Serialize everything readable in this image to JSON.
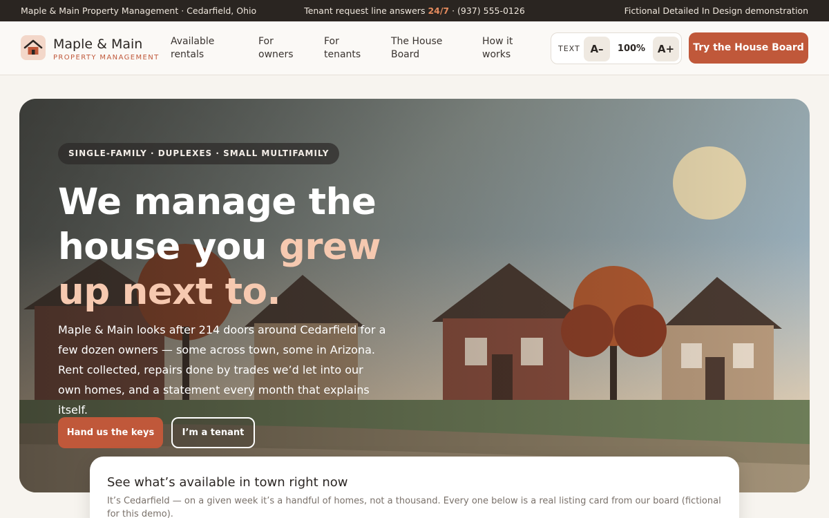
{
  "topbar": {
    "left": "Maple & Main Property Management · Cedarfield, Ohio",
    "center_prefix": "Tenant request line answers ",
    "center_accent": "24/7",
    "center_suffix": " · (937) 555-0126",
    "right": "Fictional Detailed In Design demonstration"
  },
  "brand": {
    "name": "Maple & Main",
    "tagline": "PROPERTY MANAGEMENT",
    "logo_icon": "house-icon"
  },
  "nav": {
    "items": [
      {
        "line1": "Available",
        "line2": "rentals"
      },
      {
        "line1": "For",
        "line2": "owners"
      },
      {
        "line1": "For",
        "line2": "tenants"
      },
      {
        "line1": "The House",
        "line2": "Board"
      },
      {
        "line1": "How it",
        "line2": "works"
      }
    ]
  },
  "text_control": {
    "label": "TEXT",
    "decrease": "A–",
    "value": "100%",
    "increase": "A+"
  },
  "header_cta": "Try the House Board",
  "hero": {
    "eyebrow": "SINGLE-FAMILY · DUPLEXES · SMALL MULTIFAMILY",
    "headline_a": "We manage the house you ",
    "headline_highlight": "grew up next to.",
    "body": "Maple & Main looks after 214 doors around Cedarfield for a few dozen owners — some across town, some in Arizona. Rent collected, repairs done by trades we’d let into our own homes, and a statement every month that explains itself.",
    "primary_button": "Hand us the keys",
    "secondary_button": "I’m a tenant"
  },
  "availability": {
    "title": "See what’s available in town right now",
    "text": "It’s Cedarfield — on a given week it’s a handful of homes, not a thousand. Every one below is a real listing card from our board (fictional for this demo)."
  },
  "colors": {
    "accent": "#c0583a",
    "dark": "#2a2521",
    "highlight": "#f6c9b0"
  }
}
